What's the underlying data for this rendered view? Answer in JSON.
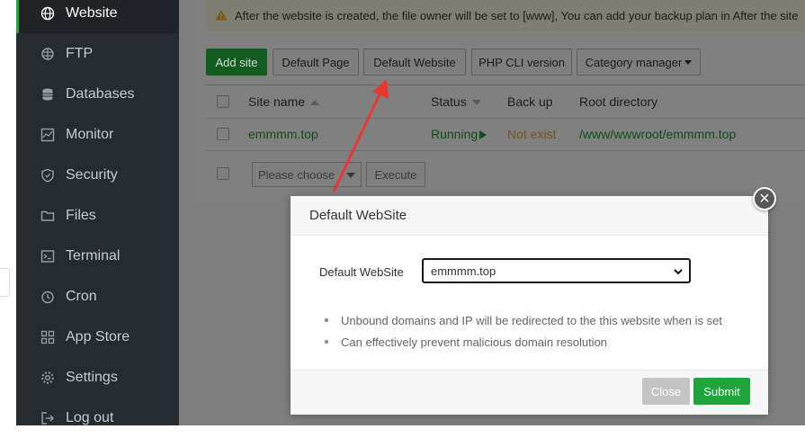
{
  "sidebar": {
    "items": [
      {
        "label": "Website",
        "icon": "globe-icon",
        "active": true
      },
      {
        "label": "FTP",
        "icon": "ftp-icon"
      },
      {
        "label": "Databases",
        "icon": "database-icon"
      },
      {
        "label": "Monitor",
        "icon": "monitor-icon"
      },
      {
        "label": "Security",
        "icon": "shield-icon"
      },
      {
        "label": "Files",
        "icon": "folder-icon"
      },
      {
        "label": "Terminal",
        "icon": "terminal-icon"
      },
      {
        "label": "Cron",
        "icon": "clock-icon"
      },
      {
        "label": "App Store",
        "icon": "grid-icon"
      },
      {
        "label": "Settings",
        "icon": "gear-icon"
      },
      {
        "label": "Log out",
        "icon": "logout-icon"
      }
    ]
  },
  "notice": {
    "text": "After the website is created, the file owner will be set to [www], You can add your backup plan in After the site"
  },
  "toolbar": {
    "add_site": "Add site",
    "default_page": "Default Page",
    "default_website": "Default Website",
    "php_cli": "PHP CLI version",
    "category_manager": "Category manager"
  },
  "table": {
    "headers": {
      "site_name": "Site name",
      "status": "Status",
      "backup": "Back up",
      "root": "Root directory"
    },
    "rows": [
      {
        "site": "emmmm.top",
        "status": "Running",
        "backup": "Not exist",
        "root": "/www/wwwroot/emmmm.top"
      }
    ]
  },
  "batch": {
    "placeholder": "Please choose",
    "execute": "Execute"
  },
  "modal": {
    "title": "Default WebSite",
    "field_label": "Default WebSite",
    "selected": "emmmm.top",
    "notes": [
      "Unbound domains and IP will be redirected to the this website when is set",
      "Can effectively prevent malicious domain resolution"
    ],
    "close": "Close",
    "submit": "Submit"
  },
  "colors": {
    "accent": "#20a53a",
    "sidebar_bg": "#262b30",
    "annotation_arrow": "#e8392f"
  }
}
